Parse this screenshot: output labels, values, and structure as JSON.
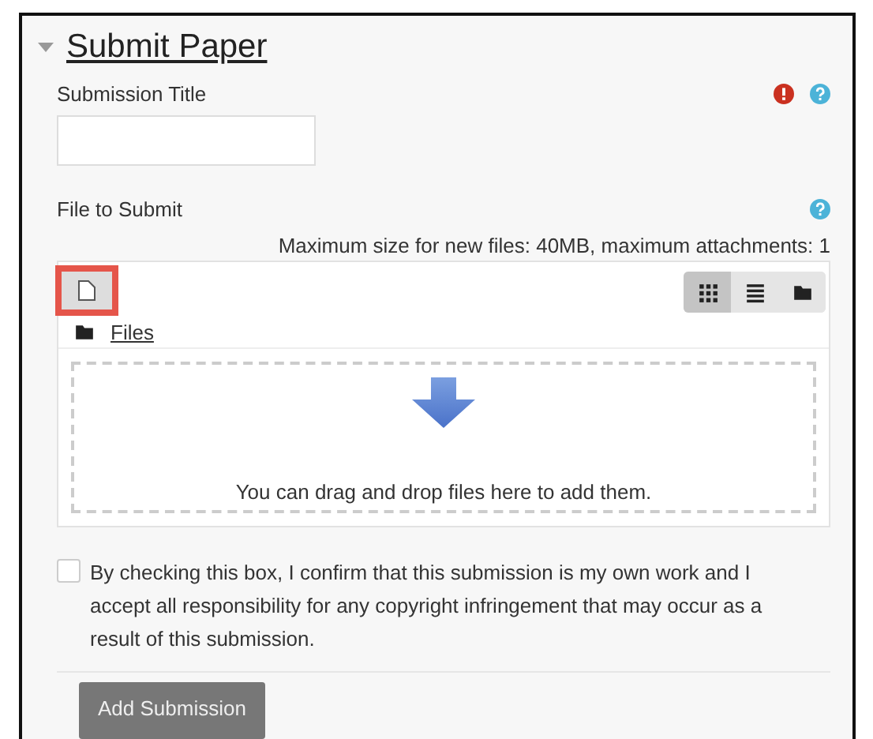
{
  "section": {
    "title": "Submit Paper",
    "expanded": true
  },
  "title_field": {
    "label": "Submission Title",
    "required": true,
    "help": true
  },
  "file_field": {
    "label": "File to Submit",
    "help": true,
    "limits": "Maximum size for new files: 40MB, maximum attachments: 1",
    "views": [
      {
        "kind": "grid",
        "selected": true
      },
      {
        "kind": "list",
        "selected": false
      },
      {
        "kind": "tree",
        "selected": false
      }
    ],
    "folder": "Files",
    "drop_hint": "You can drag and drop files here to add them."
  },
  "confirm": {
    "checked": false,
    "text": "By checking this box, I confirm that this submission is my own work and I accept all responsibility for any copyright infringement that may occur as a result of this submission."
  },
  "submit": "Add Submission"
}
